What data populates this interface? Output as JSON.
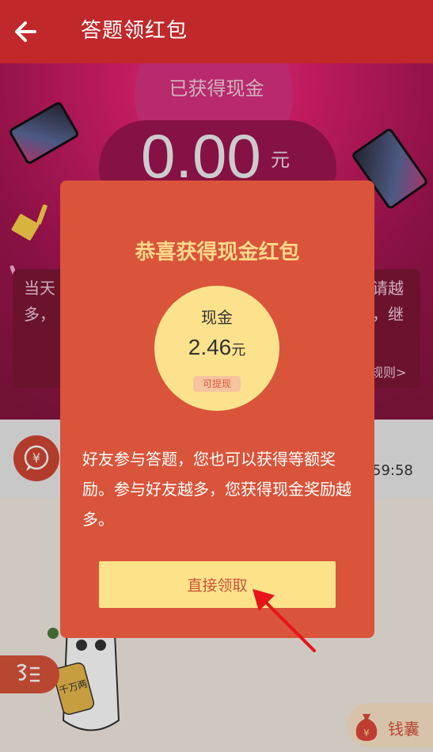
{
  "header": {
    "title": "答题领红包"
  },
  "banner": {
    "earned_label": "已获得现金",
    "amount": "0.00",
    "unit": "元",
    "rules_left": [
      "当天",
      "多，"
    ],
    "rules_right": [
      "请越",
      "，继"
    ],
    "rules_link": "规则>"
  },
  "list": {
    "time": "59:58"
  },
  "modal": {
    "title": "恭喜获得现金红包",
    "cash_label": "现金",
    "cash_value": "2.46",
    "cash_unit": "元",
    "cash_badge": "可提现",
    "description": "好友参与答题，您也可以获得等额奖励。参与好友越多，您获得现金奖励越多。",
    "claim_button": "直接领取"
  },
  "mascot": {
    "tag_text": "千万两"
  },
  "wallet": {
    "label": "钱囊"
  },
  "colors": {
    "header": "#c1282a",
    "modal": "#d9543a",
    "button": "#fde28a",
    "title_gold": "#fdd88a"
  },
  "icons": [
    "back-arrow-icon",
    "chat-yuan-icon",
    "menu-icon",
    "money-bag-icon",
    "pointer-arrow-icon"
  ]
}
